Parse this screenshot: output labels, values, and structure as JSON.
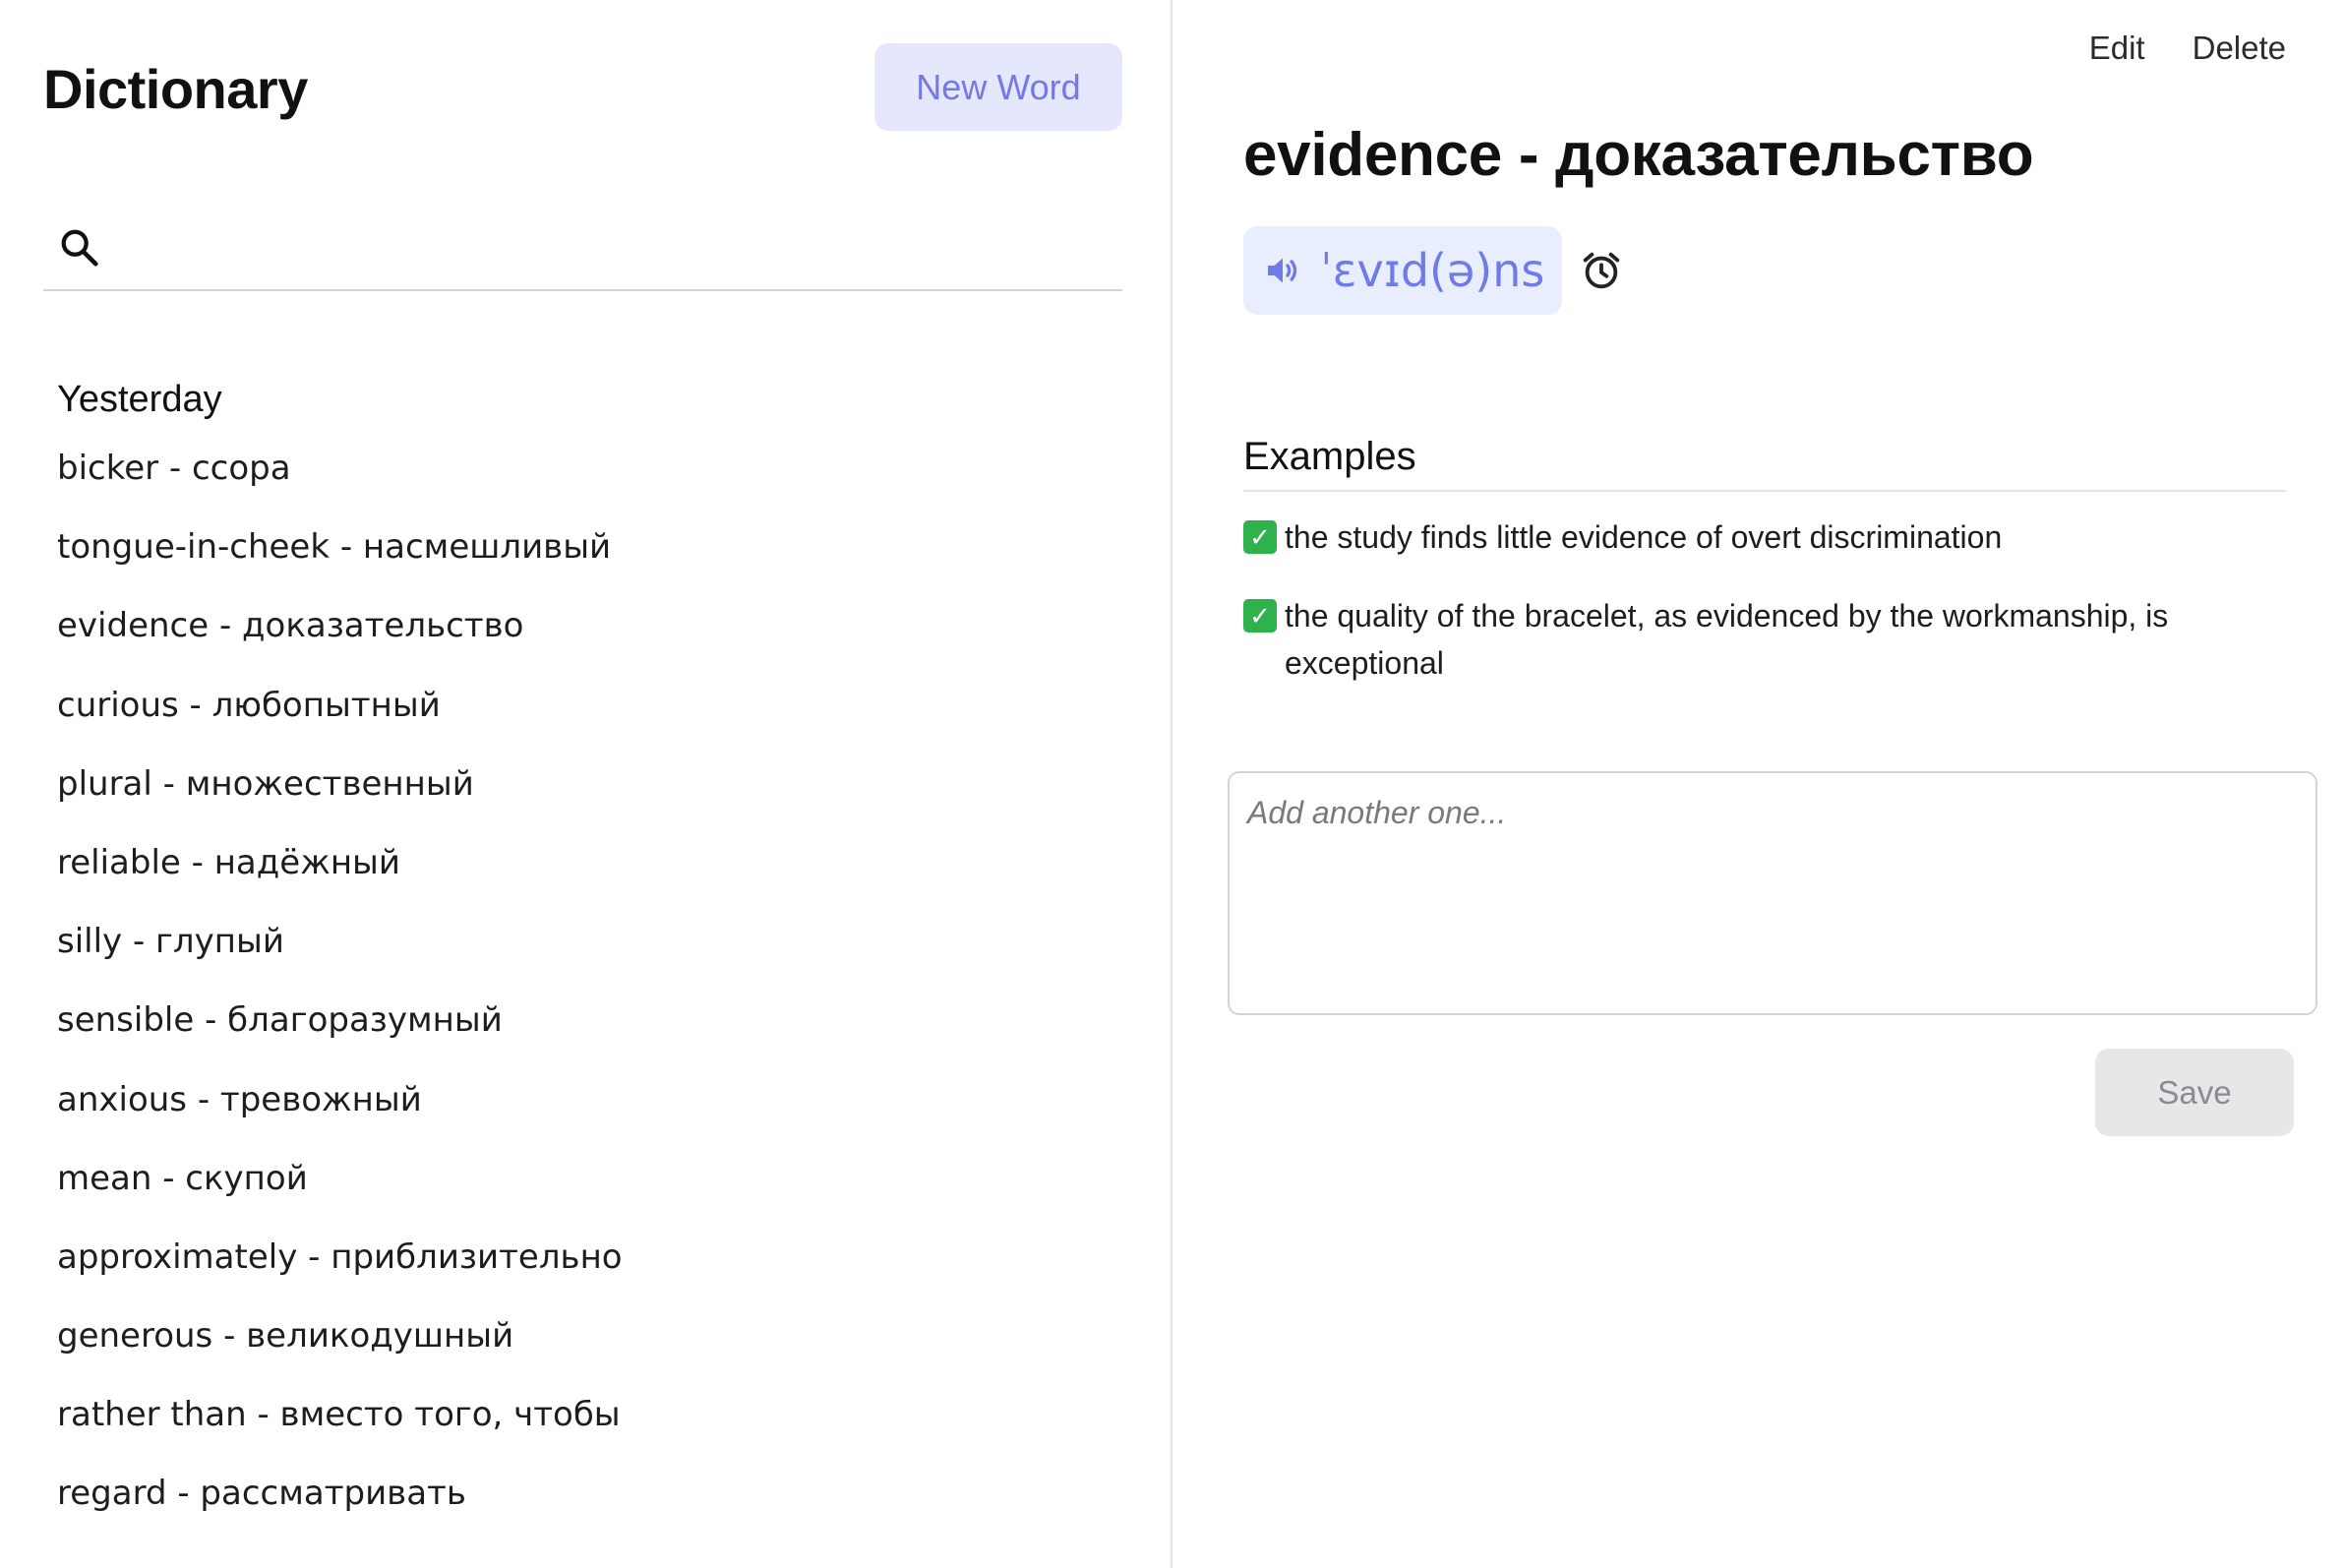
{
  "sidebar": {
    "title": "Dictionary",
    "new_word_label": "New Word",
    "search": {
      "placeholder": "",
      "value": ""
    },
    "groups": [
      {
        "label": "Yesterday",
        "items": [
          "bicker - ссора",
          "tongue-in-cheek - насмешливый",
          "evidence - доказательство",
          "curious - любопытный",
          "plural - множественный",
          "reliable - надёжный",
          "silly - глупый",
          "sensible - благоразумный",
          "anxious - тревожный",
          "mean - скупой",
          "approximately - приблизительно",
          "generous - великодушный",
          "rather than - вместо того, чтобы",
          "regard - рассматривать"
        ]
      }
    ]
  },
  "detail": {
    "edit_label": "Edit",
    "delete_label": "Delete",
    "word_title": "evidence - доказательство",
    "pronunciation": "ˈɛvɪd(ə)ns",
    "examples_heading": "Examples",
    "examples": [
      "the study finds little evidence of overt discrimination",
      "the quality of the bracelet, as evidenced by the workmanship, is exceptional"
    ],
    "new_example": {
      "placeholder": "Add another one...",
      "value": ""
    },
    "save_label": "Save"
  },
  "colors": {
    "accent": "#7379e8",
    "accent_bg": "#e5e8fd",
    "check": "#2fb24c",
    "divider": "#e4e4e7"
  },
  "icons": [
    "search-icon",
    "speaker-icon",
    "alarm-clock-icon",
    "checkmark-icon"
  ]
}
